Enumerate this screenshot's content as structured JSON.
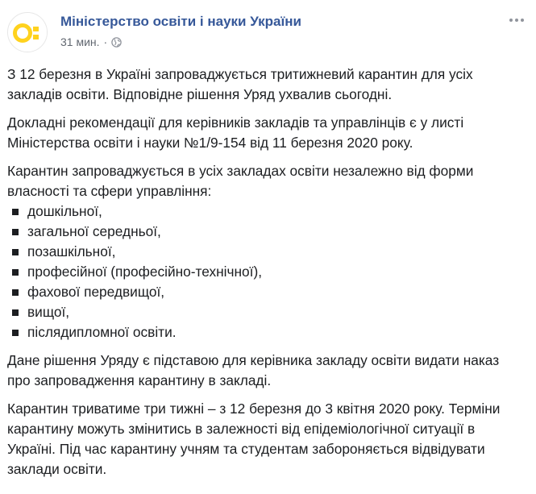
{
  "post": {
    "author": "Міністерство освіти і науки України",
    "time": "31 мин.",
    "separator": "·",
    "privacy_icon": "globe-icon",
    "more_icon": "more-options-icon",
    "avatar_icon": "mon-logo",
    "paragraphs": [
      "З 12 березня в Україні запроваджується тритижневий карантин для усіх закладів освіти. Відповідне рішення Уряд ухвалив сьогодні.",
      "Докладні рекомендації для керівників закладів та управлінців є у листі Міністерства освіти і науки №1/9-154 від 11 березня 2020 року.",
      "Карантин запроваджується в усіх закладах освіти незалежно від форми власності та сфери управління:"
    ],
    "list": [
      "дошкільної,",
      "загальної середньої,",
      "позашкільної,",
      "професійної (професійно-технічної),",
      "фахової передвищої,",
      "вищої,",
      "післядипломної освіти."
    ],
    "paragraphs_after": [
      "Дане рішення Уряду є підставою для керівника закладу освіти видати наказ про запровадження карантину в закладі.",
      "Карантин триватиме три тижні – з 12 березня до 3 квітня 2020 року. Терміни карантину можуть змінитись в залежності від епідеміологічної ситуації в Україні. Під час карантину учням та студентам забороняється відвідувати заклади освіти."
    ],
    "colors": {
      "logo_yellow": "#ffd21e",
      "link_blue": "#365899",
      "text": "#1c1e21",
      "meta_grey": "#616770"
    }
  }
}
